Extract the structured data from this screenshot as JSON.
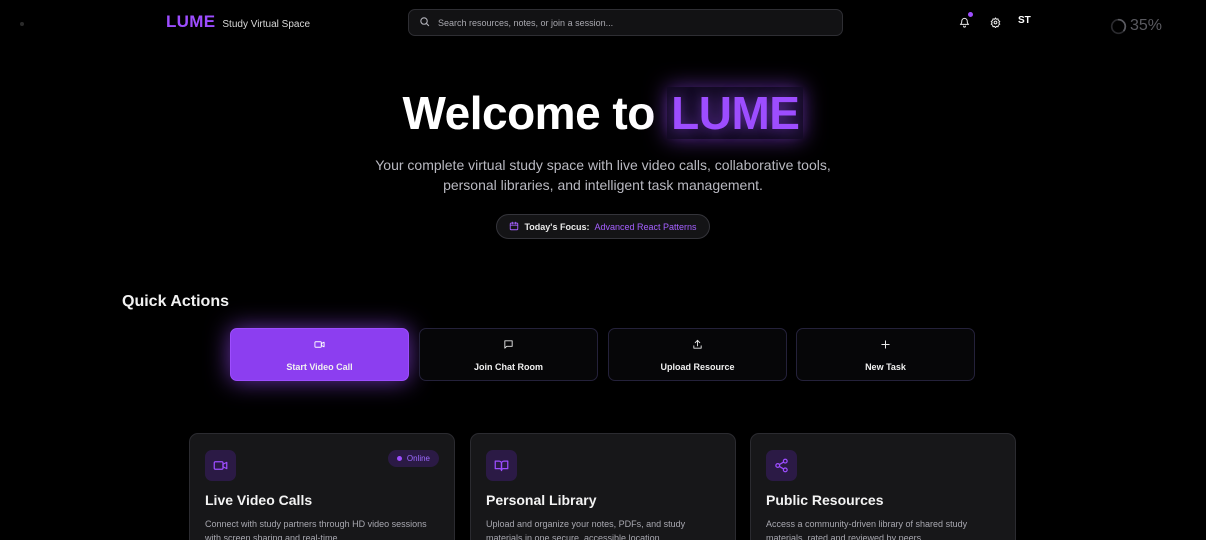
{
  "header": {
    "brand": "LUME",
    "brand_subtitle": "Study Virtual Space",
    "search_placeholder": "Search resources, notes, or join a session...",
    "notification_icon": "bell-icon",
    "settings_icon": "gear-icon",
    "avatar_initials": "ST",
    "progress_text": "35%",
    "progress_fraction": 0.35
  },
  "hero": {
    "title_prefix": "Welcome to",
    "title_accent": "LUME",
    "subtitle_line1": "Your complete virtual study space with live video calls, collaborative tools,",
    "subtitle_line2": "personal libraries, and intelligent task management.",
    "focus_label": "Today's Focus:",
    "focus_value": "Advanced React Patterns",
    "focus_icon": "calendar-icon"
  },
  "quick_actions": {
    "title": "Quick Actions",
    "items": [
      {
        "label": "Start Video Call",
        "icon": "video-icon",
        "primary": true
      },
      {
        "label": "Join Chat Room",
        "icon": "chat-icon",
        "primary": false
      },
      {
        "label": "Upload Resource",
        "icon": "upload-icon",
        "primary": false
      },
      {
        "label": "New Task",
        "icon": "plus-icon",
        "primary": false
      }
    ]
  },
  "features": [
    {
      "title": "Live Video Calls",
      "description": "Connect with study partners through HD video sessions with screen sharing and real-time",
      "icon": "video-icon",
      "badge": "Online"
    },
    {
      "title": "Personal Library",
      "description": "Upload and organize your notes, PDFs, and study materials in one secure, accessible location",
      "icon": "book-icon"
    },
    {
      "title": "Public Resources",
      "description": "Access a community-driven library of shared study materials, rated and reviewed by peers",
      "icon": "share-icon"
    }
  ],
  "colors": {
    "accent": "#9d4dff",
    "background": "#000000",
    "card": "#171719"
  }
}
